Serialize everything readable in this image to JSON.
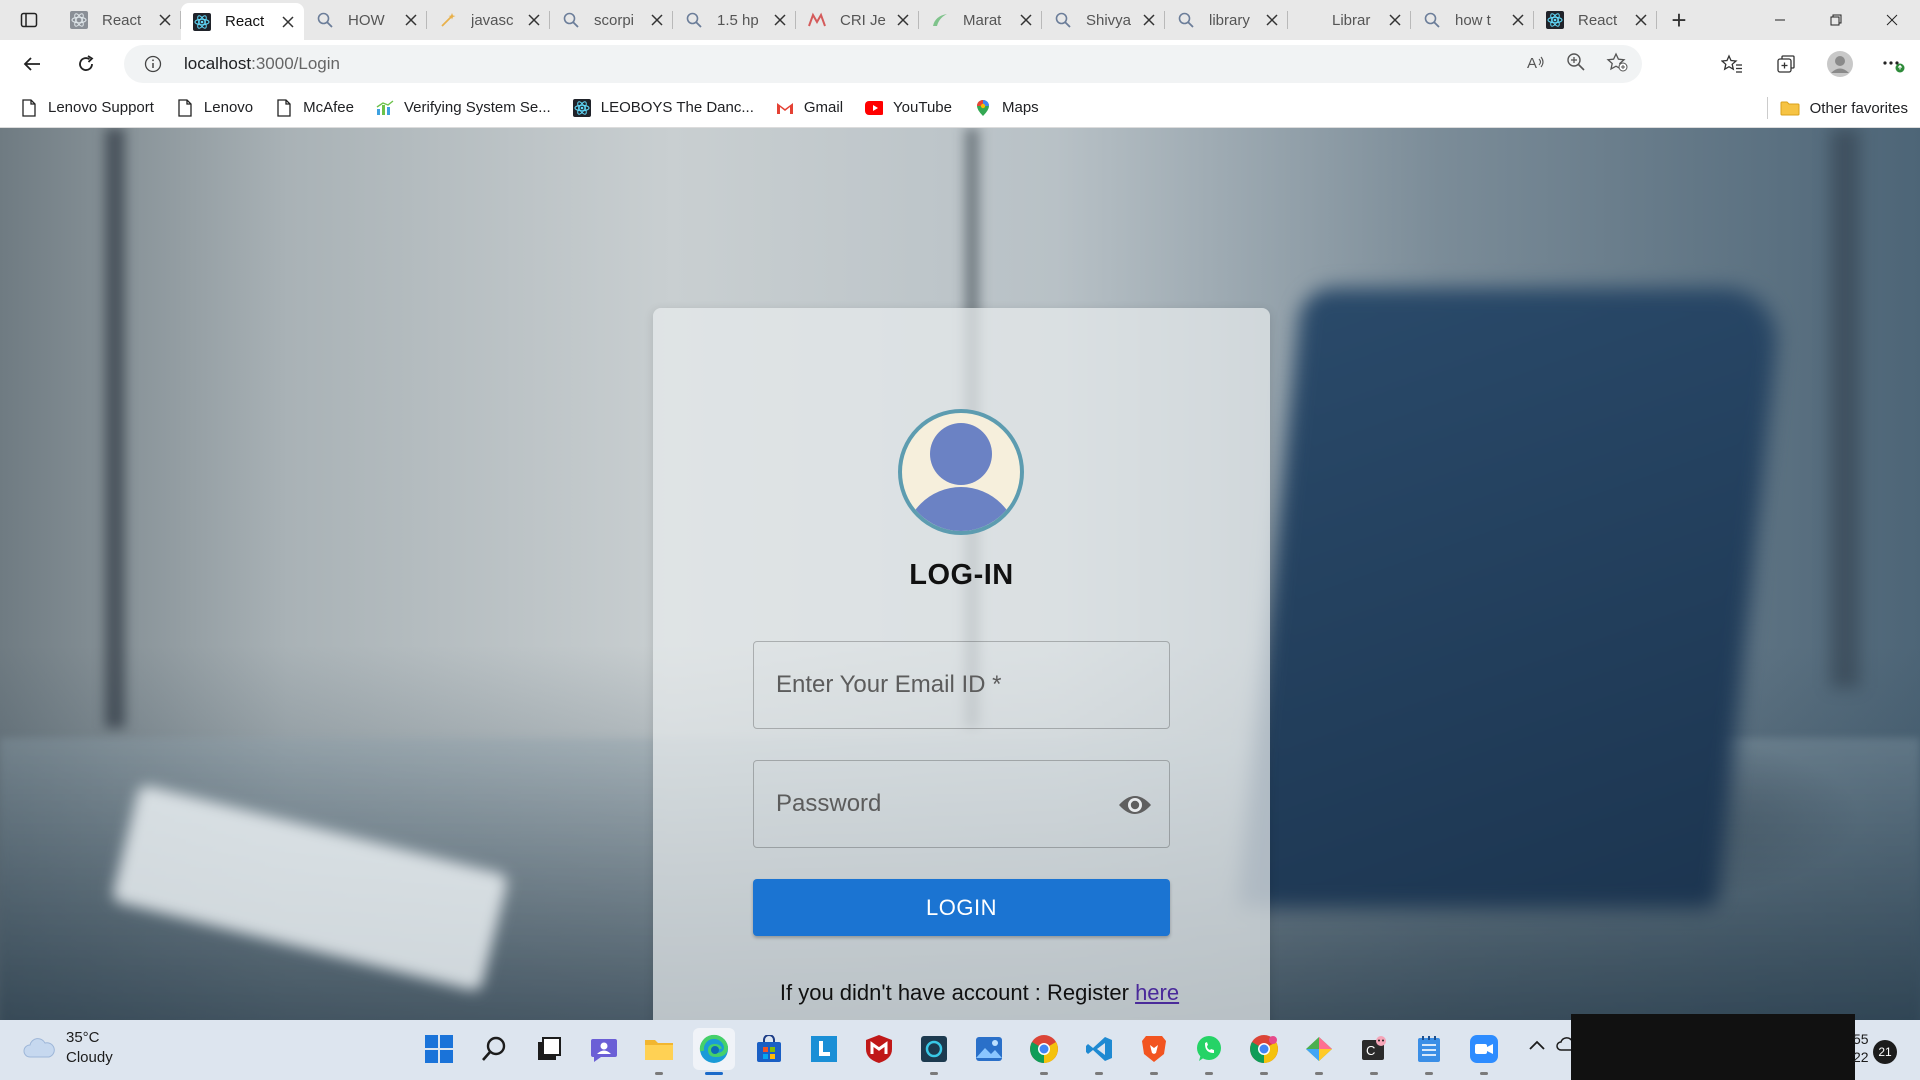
{
  "browser": {
    "tabs": [
      {
        "title": "React",
        "favicon": "react-gray-icon",
        "active": false
      },
      {
        "title": "React",
        "favicon": "react-icon",
        "active": true
      },
      {
        "title": "HOW",
        "favicon": "search-icon",
        "active": false
      },
      {
        "title": "javasc",
        "favicon": "wand-icon",
        "active": false
      },
      {
        "title": "scorpi",
        "favicon": "search-icon",
        "active": false
      },
      {
        "title": "1.5 hp",
        "favicon": "search-icon",
        "active": false
      },
      {
        "title": "CRI Je",
        "favicon": "cri-icon",
        "active": false
      },
      {
        "title": "Marat",
        "favicon": "marathon-icon",
        "active": false
      },
      {
        "title": "Shivya",
        "favicon": "search-icon",
        "active": false
      },
      {
        "title": "library",
        "favicon": "search-icon",
        "active": false
      },
      {
        "title": "Librar",
        "favicon": "blank-icon",
        "active": false
      },
      {
        "title": "how t",
        "favicon": "search-icon",
        "active": false
      },
      {
        "title": "React",
        "favicon": "react-icon",
        "active": false
      }
    ],
    "address": {
      "host": "localhost",
      "path": ":3000/Login"
    },
    "favorites": [
      {
        "label": "Lenovo Support",
        "icon": "page-icon"
      },
      {
        "label": "Lenovo",
        "icon": "page-icon"
      },
      {
        "label": "McAfee",
        "icon": "page-icon"
      },
      {
        "label": "Verifying System Se...",
        "icon": "chart-icon"
      },
      {
        "label": "LEOBOYS The Danc...",
        "icon": "react-icon"
      },
      {
        "label": "Gmail",
        "icon": "gmail-icon"
      },
      {
        "label": "YouTube",
        "icon": "youtube-icon"
      },
      {
        "label": "Maps",
        "icon": "maps-icon"
      }
    ],
    "other_favorites": "Other favorites"
  },
  "login": {
    "title": "LOG-IN",
    "email_placeholder": "Enter Your Email ID *",
    "password_placeholder": "Password",
    "button_label": "LOGIN",
    "register_text": "If you didn't have account : Register ",
    "register_link": "here"
  },
  "taskbar": {
    "weather_temp": "35°C",
    "weather_desc": "Cloudy",
    "clock_line1": "55",
    "clock_line2": "22",
    "notifications": "21"
  },
  "colors": {
    "accent": "#1b74d2",
    "link": "#4a2a9a",
    "avatar_fill": "#6b82c4",
    "avatar_ring": "#5d9cb0"
  }
}
